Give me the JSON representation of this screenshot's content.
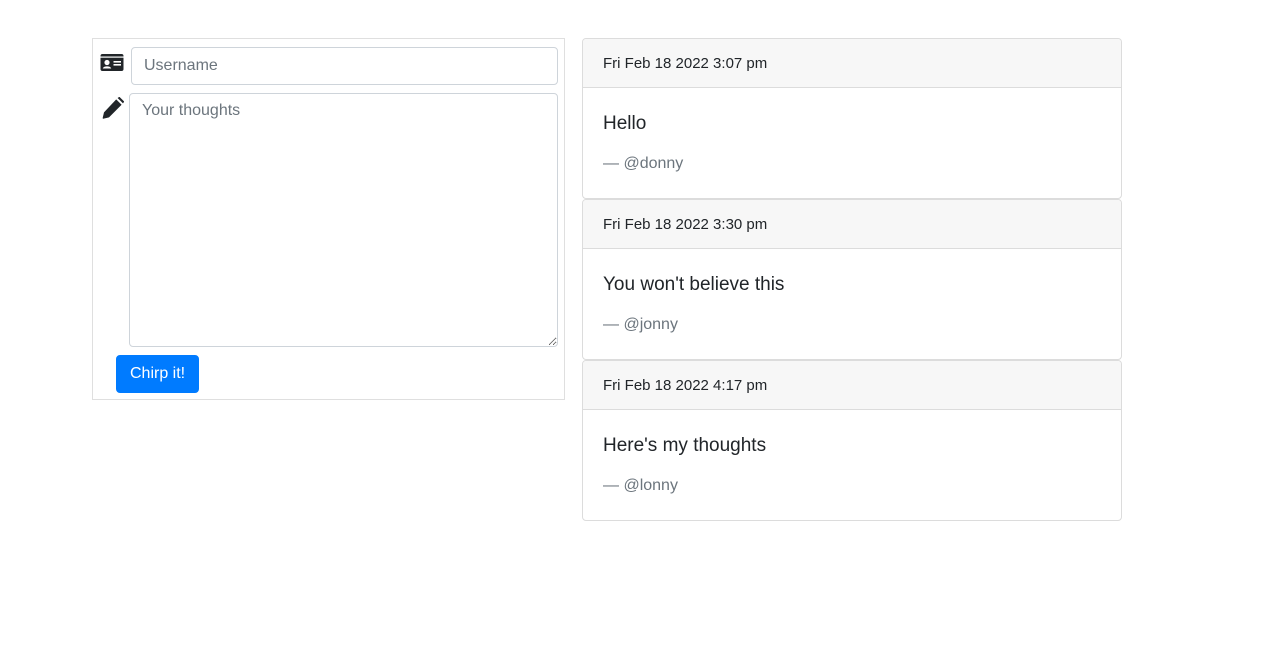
{
  "compose": {
    "username_placeholder": "Username",
    "thoughts_placeholder": "Your thoughts",
    "submit_label": "Chirp it!",
    "icons": {
      "username": "id-card-icon",
      "thoughts": "pencil-icon"
    }
  },
  "chirps": [
    {
      "timestamp": "Fri Feb 18 2022 3:07 pm",
      "text": "Hello",
      "author": "— @donny"
    },
    {
      "timestamp": "Fri Feb 18 2022 3:30 pm",
      "text": "You won't believe this",
      "author": "— @jonny"
    },
    {
      "timestamp": "Fri Feb 18 2022 4:17 pm",
      "text": "Here's my thoughts",
      "author": "— @lonny"
    }
  ],
  "colors": {
    "primary": "#007bff",
    "header_bg": "#f7f7f7",
    "muted_text": "#6c757d"
  }
}
